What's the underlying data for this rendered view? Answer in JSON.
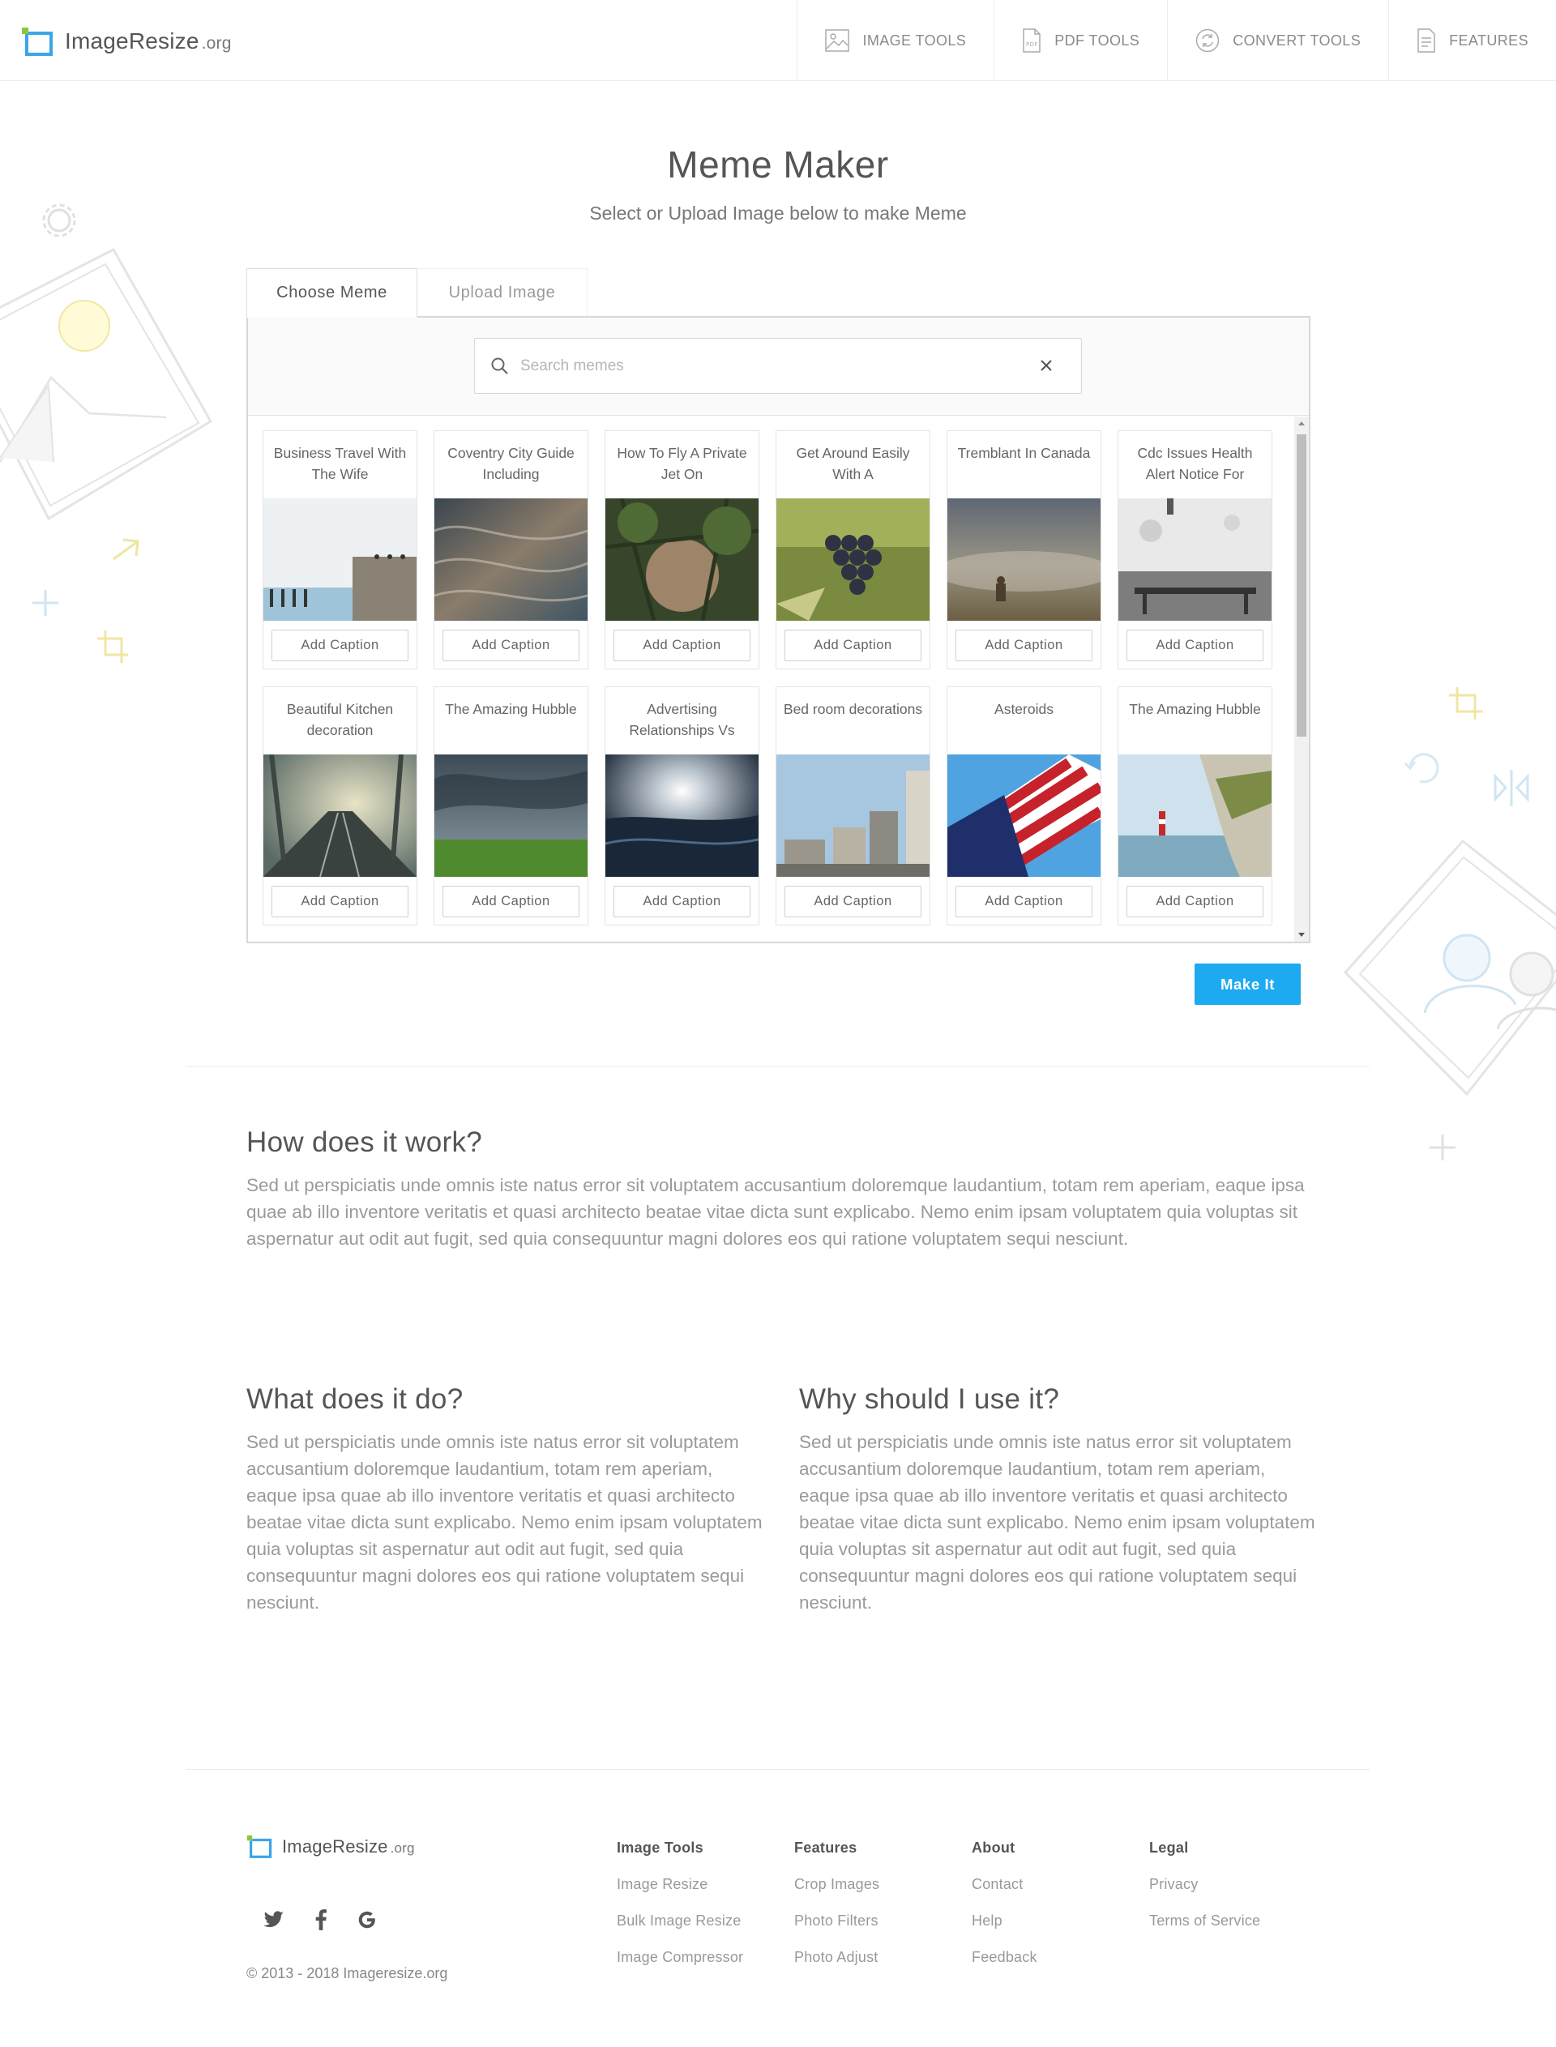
{
  "brand": {
    "name": "ImageResize",
    "tld": ".org"
  },
  "nav": [
    {
      "label": "IMAGE TOOLS",
      "icon": "image-icon"
    },
    {
      "label": "PDF TOOLS",
      "icon": "pdf-icon"
    },
    {
      "label": "CONVERT TOOLS",
      "icon": "convert-icon"
    },
    {
      "label": "FEATURES",
      "icon": "document-icon"
    }
  ],
  "hero": {
    "title": "Meme Maker",
    "subtitle": "Select or Upload Image below to make Meme"
  },
  "tabs": {
    "choose": "Choose Meme",
    "upload": "Upload Image"
  },
  "search": {
    "placeholder": "Search memes",
    "value": ""
  },
  "memes": [
    {
      "title": "Business Travel With The Wife",
      "button": "Add Caption"
    },
    {
      "title": "Coventry City Guide Including",
      "button": "Add Caption"
    },
    {
      "title": "How To Fly A Private Jet On",
      "button": "Add Caption"
    },
    {
      "title": "Get Around Easily With A",
      "button": "Add Caption"
    },
    {
      "title": "Tremblant In Canada",
      "button": "Add Caption"
    },
    {
      "title": "Cdc Issues Health Alert Notice For",
      "button": "Add Caption"
    },
    {
      "title": "Beautiful Kitchen decoration",
      "button": "Add Caption"
    },
    {
      "title": "The Amazing Hubble",
      "button": "Add Caption"
    },
    {
      "title": "Advertising Relationships Vs",
      "button": "Add Caption"
    },
    {
      "title": "Bed room decorations",
      "button": "Add Caption"
    },
    {
      "title": "Asteroids",
      "button": "Add Caption"
    },
    {
      "title": "The Amazing Hubble",
      "button": "Add Caption"
    }
  ],
  "make_button": "Make It",
  "sections": {
    "how": {
      "title": "How does it work?",
      "text": "Sed ut perspiciatis unde omnis iste natus error sit voluptatem accusantium doloremque laudantium, totam rem aperiam, eaque ipsa quae ab illo inventore veritatis et quasi architecto beatae vitae dicta sunt explicabo. Nemo enim ipsam voluptatem quia voluptas sit aspernatur aut odit aut fugit, sed quia consequuntur magni dolores eos qui ratione voluptatem sequi nesciunt."
    },
    "what": {
      "title": "What does it do?",
      "text": "Sed ut perspiciatis unde omnis iste natus error sit voluptatem accusantium doloremque laudantium, totam rem aperiam, eaque ipsa quae ab illo inventore veritatis et quasi architecto beatae vitae dicta sunt explicabo. Nemo enim ipsam voluptatem quia voluptas sit aspernatur aut odit aut fugit, sed quia consequuntur magni dolores eos qui ratione voluptatem sequi nesciunt."
    },
    "why": {
      "title": "Why should I use it?",
      "text": "Sed ut perspiciatis unde omnis iste natus error sit voluptatem accusantium doloremque laudantium, totam rem aperiam, eaque ipsa quae ab illo inventore veritatis et quasi architecto beatae vitae dicta sunt explicabo. Nemo enim ipsam voluptatem quia voluptas sit aspernatur aut odit aut fugit, sed quia consequuntur magni dolores eos qui ratione voluptatem sequi nesciunt."
    }
  },
  "footer": {
    "social": [
      "twitter-icon",
      "facebook-icon",
      "google-icon"
    ],
    "copyright": "© 2013 - 2018 Imageresize.org",
    "columns": [
      {
        "title": "Image Tools",
        "links": [
          "Image Resize",
          "Bulk Image Resize",
          "Image Compressor"
        ]
      },
      {
        "title": "Features",
        "links": [
          "Crop Images",
          "Photo Filters",
          "Photo Adjust"
        ]
      },
      {
        "title": "About",
        "links": [
          "Contact",
          "Help",
          "Feedback"
        ]
      },
      {
        "title": "Legal",
        "links": [
          "Privacy",
          "Terms of Service"
        ]
      }
    ]
  },
  "colors": {
    "accent": "#1eaaf1",
    "logo_blue": "#3aa6e8",
    "logo_green": "#8cc63f"
  }
}
